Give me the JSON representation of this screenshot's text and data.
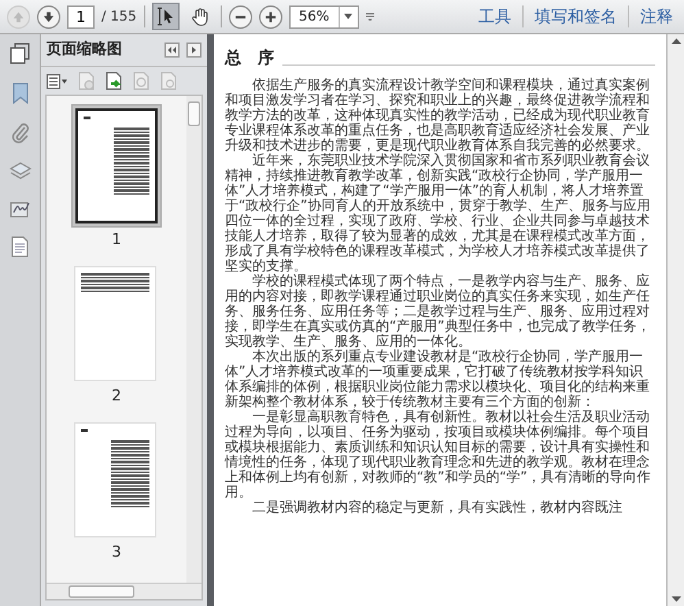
{
  "toolbar": {
    "nav": [
      {
        "kind": "prev",
        "disabled": true
      },
      {
        "kind": "next",
        "disabled": false
      }
    ],
    "page_input": "1",
    "page_count": "/ 155",
    "tools": [
      {
        "kind": "select",
        "selected": true
      },
      {
        "kind": "hand",
        "selected": false
      }
    ],
    "zoom": "56%",
    "menus": [
      "工具",
      "填写和签名",
      "注释"
    ]
  },
  "sidebar": {
    "title": "页面缩略图",
    "thumbnails": [
      {
        "label": "1",
        "selected": true,
        "kind": "heading"
      },
      {
        "label": "2",
        "selected": false,
        "kind": "short"
      },
      {
        "label": "3",
        "selected": false,
        "kind": "heading"
      }
    ]
  },
  "document": {
    "heading": "总　序",
    "paragraphs": [
      "依据生产服务的真实流程设计教学空间和课程模块，通过真实案例和项目激发学习者在学习、探究和职业上的兴趣，最终促进教学流程和教学方法的改革，这种体现真实性的教学活动，已经成为现代职业教育专业课程体系改革的重点任务，也是高职教育适应经济社会发展、产业升级和技术进步的需要，更是现代职业教育体系自我完善的必然要求。",
      "近年来，东莞职业技术学院深入贯彻国家和省市系列职业教育会议精神，持续推进教育教学改革，创新实践“政校行企协同，学产服用一体”人才培养模式，构建了“学产服用一体”的育人机制，将人才培养置于“政校行企”协同育人的开放系统中，贯穿于教学、生产、服务与应用四位一体的全过程，实现了政府、学校、行业、企业共同参与卓越技术技能人才培养，取得了较为显著的成效，尤其是在课程模式改革方面，形成了具有学校特色的课程改革模式，为学校人才培养模式改革提供了坚实的支撑。",
      "学校的课程模式体现了两个特点，一是教学内容与生产、服务、应用的内容对接，即教学课程通过职业岗位的真实任务来实现，如生产任务、服务任务、应用任务等；二是教学过程与生产、服务、应用过程对接，即学生在真实或仿真的“产服用”典型任务中，也完成了教学任务，实现教学、生产、服务、应用的一体化。",
      "本次出版的系列重点专业建设教材是“政校行企协同，学产服用一体”人才培养模式改革的一项重要成果，它打破了传统教材按学科知识体系编排的体例，根据职业岗位能力需求以模块化、项目化的结构来重新架构整个教材体系，较于传统教材主要有三个方面的创新：",
      "一是彰显高职教育特色，具有创新性。教材以社会生活及职业活动过程为导向，以项目、任务为驱动，按项目或模块体例编排。每个项目或模块根据能力、素质训练和知识认知目标的需要，设计具有实操性和情境性的任务，体现了现代职业教育理念和先进的教学观。教材在理念上和体例上均有创新，对教师的“教”和学员的“学”，具有清晰的导向作用。",
      "二是强调教材内容的稳定与更新，具有实践性，教材内容既注"
    ]
  }
}
